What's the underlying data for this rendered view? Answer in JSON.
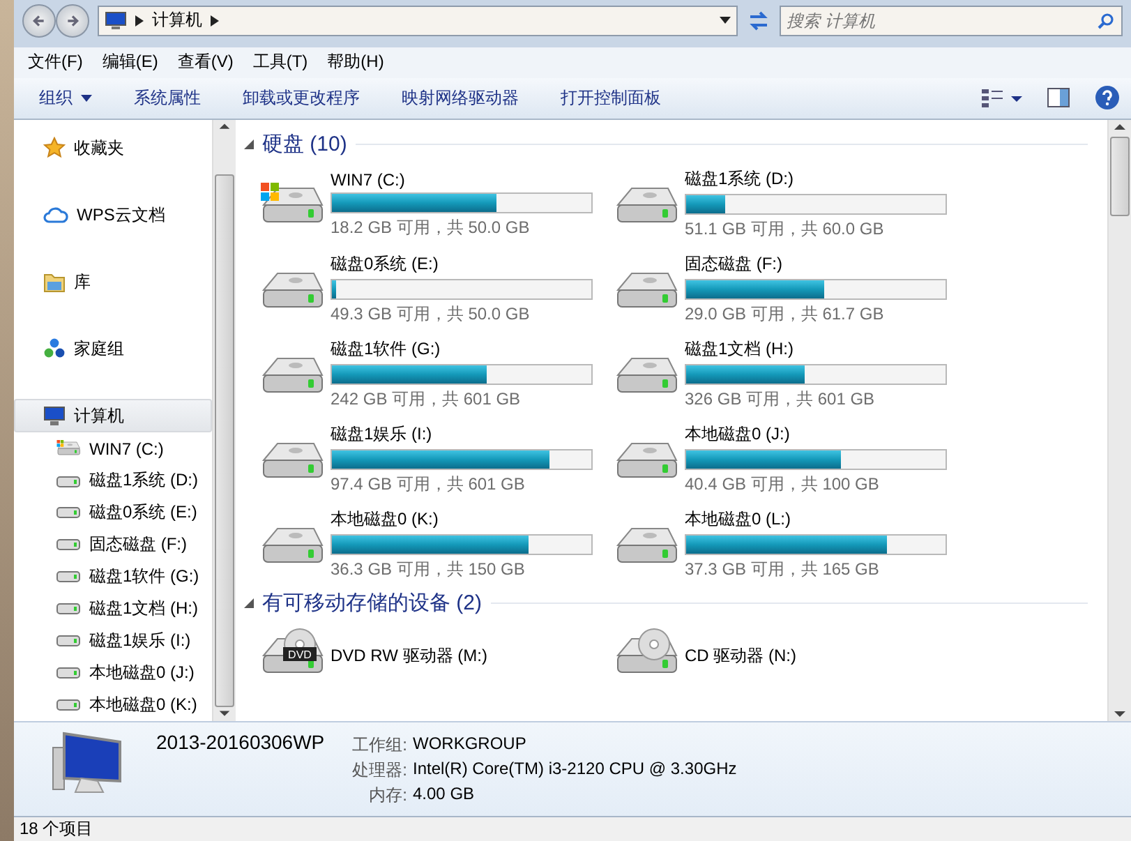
{
  "address_bar": {
    "path": [
      "计算机"
    ],
    "search_placeholder": "搜索 计算机"
  },
  "menu": [
    "文件(F)",
    "编辑(E)",
    "查看(V)",
    "工具(T)",
    "帮助(H)"
  ],
  "toolbar": {
    "organize": "组织",
    "buttons": [
      "系统属性",
      "卸载或更改程序",
      "映射网络驱动器",
      "打开控制面板"
    ]
  },
  "sidebar": {
    "items": [
      {
        "label": "收藏夹",
        "kind": "favorites",
        "selected": false
      },
      {
        "label": "WPS云文档",
        "kind": "cloud",
        "selected": false
      },
      {
        "label": "库",
        "kind": "library",
        "selected": false
      },
      {
        "label": "家庭组",
        "kind": "homegroup",
        "selected": false
      },
      {
        "label": "计算机",
        "kind": "computer",
        "selected": true,
        "children": [
          {
            "label": "WIN7 (C:)",
            "kind": "system"
          },
          {
            "label": "磁盘1系统 (D:)",
            "kind": "hdd"
          },
          {
            "label": "磁盘0系统 (E:)",
            "kind": "hdd"
          },
          {
            "label": "固态磁盘 (F:)",
            "kind": "hdd"
          },
          {
            "label": "磁盘1软件 (G:)",
            "kind": "hdd"
          },
          {
            "label": "磁盘1文档 (H:)",
            "kind": "hdd"
          },
          {
            "label": "磁盘1娱乐 (I:)",
            "kind": "hdd"
          },
          {
            "label": "本地磁盘0 (J:)",
            "kind": "hdd"
          },
          {
            "label": "本地磁盘0 (K:)",
            "kind": "hdd"
          }
        ]
      }
    ]
  },
  "groups": [
    {
      "title": "硬盘 (10)",
      "items": [
        {
          "name": "WIN7 (C:)",
          "kind": "system",
          "level": 0.636,
          "space": "18.2 GB 可用，共 50.0 GB"
        },
        {
          "name": "磁盘1系统 (D:)",
          "kind": "hdd",
          "level": 0.148,
          "space": "51.1 GB 可用，共 60.0 GB"
        },
        {
          "name": "磁盘0系统 (E:)",
          "kind": "hdd",
          "level": 0.014,
          "space": "49.3 GB 可用，共 50.0 GB"
        },
        {
          "name": "固态磁盘 (F:)",
          "kind": "hdd",
          "level": 0.53,
          "space": "29.0 GB 可用，共 61.7 GB"
        },
        {
          "name": "磁盘1软件 (G:)",
          "kind": "hdd",
          "level": 0.597,
          "space": "242 GB 可用，共 601 GB"
        },
        {
          "name": "磁盘1文档 (H:)",
          "kind": "hdd",
          "level": 0.458,
          "space": "326 GB 可用，共 601 GB"
        },
        {
          "name": "磁盘1娱乐 (I:)",
          "kind": "hdd",
          "level": 0.838,
          "space": "97.4 GB 可用，共 601 GB"
        },
        {
          "name": "本地磁盘0 (J:)",
          "kind": "hdd",
          "level": 0.596,
          "space": "40.4 GB 可用，共 100 GB"
        },
        {
          "name": "本地磁盘0 (K:)",
          "kind": "hdd",
          "level": 0.758,
          "space": "36.3 GB 可用，共 150 GB"
        },
        {
          "name": "本地磁盘0 (L:)",
          "kind": "hdd",
          "level": 0.774,
          "space": "37.3 GB 可用，共 165 GB"
        }
      ]
    },
    {
      "title": "有可移动存储的设备 (2)",
      "items": [
        {
          "name": "DVD RW 驱动器 (M:)",
          "kind": "dvd",
          "drive_label": "DVD"
        },
        {
          "name": "CD 驱动器 (N:)",
          "kind": "cd"
        }
      ]
    }
  ],
  "details": {
    "computer_name": "2013-20160306WP",
    "rows": [
      {
        "label": "工作组:",
        "value": "WORKGROUP"
      },
      {
        "label": "处理器:",
        "value": "Intel(R) Core(TM) i3-2120 CPU @ 3.30GHz"
      },
      {
        "label": "内存:",
        "value": "4.00 GB"
      }
    ]
  },
  "status_bar": "18 个项目"
}
